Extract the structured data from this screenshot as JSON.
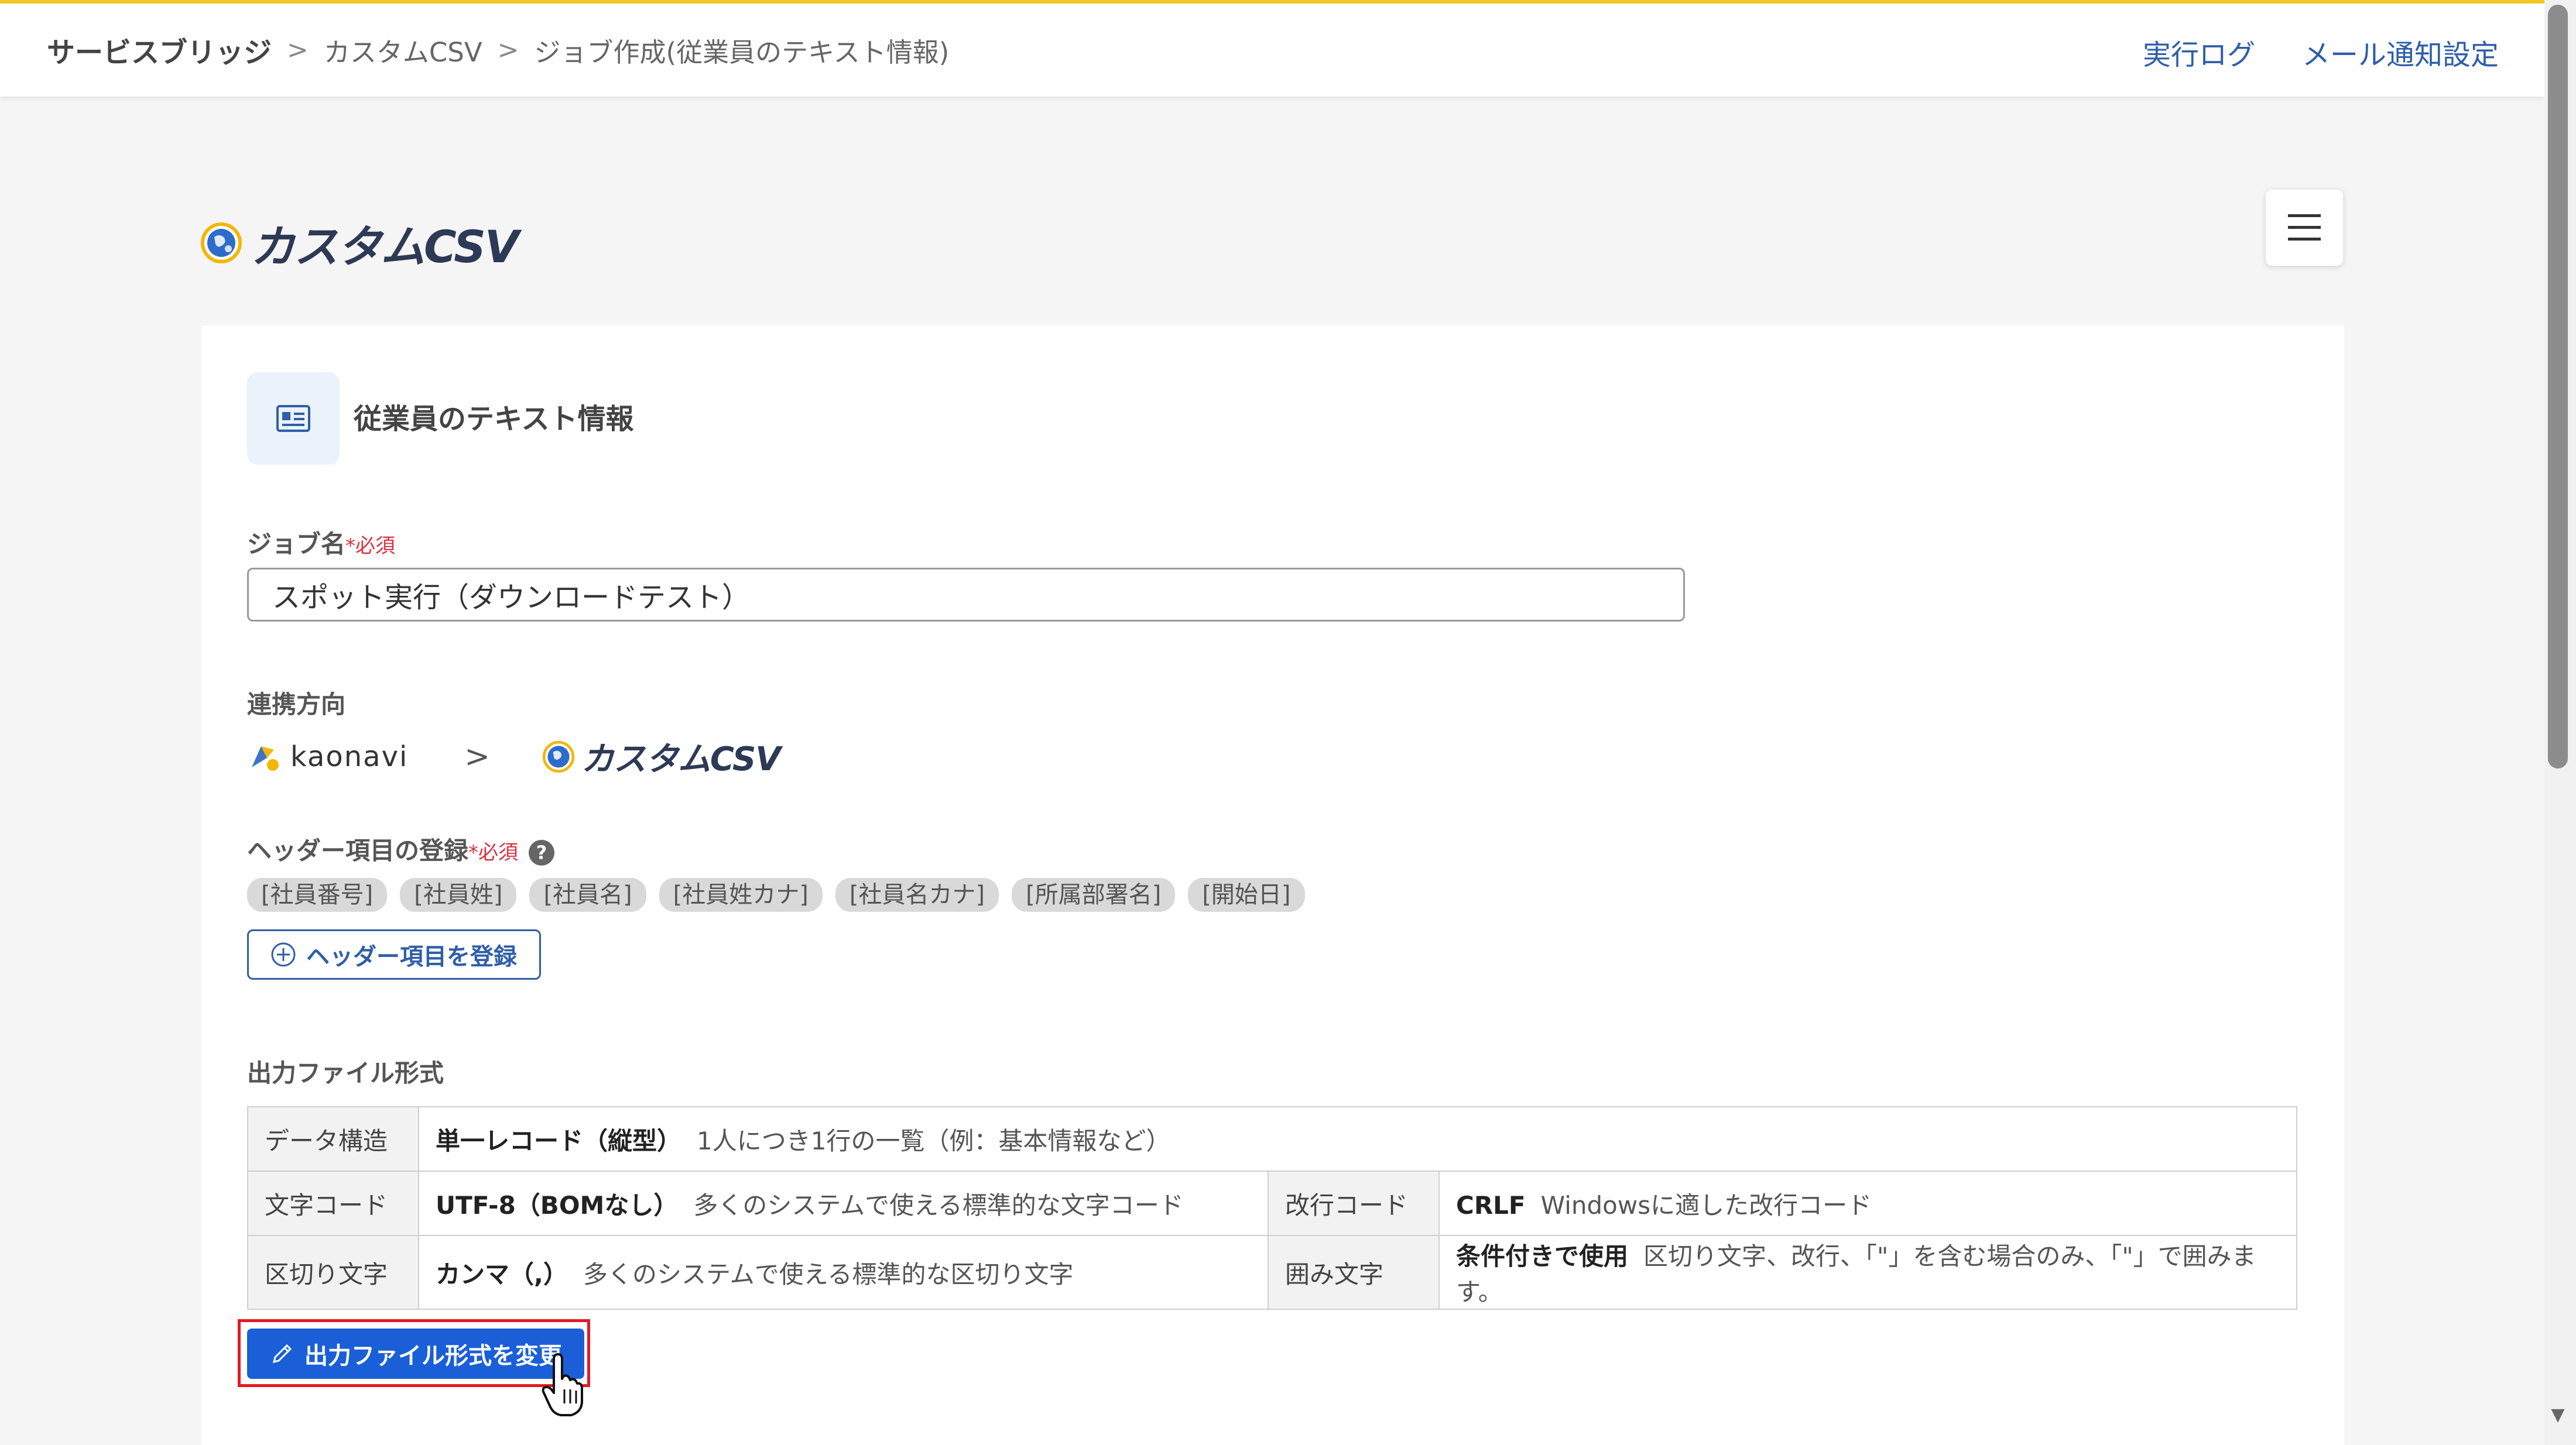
{
  "breadcrumb": {
    "root": "サービスブリッジ",
    "items": [
      "カスタムCSV",
      "ジョブ作成(従業員のテキスト情報)"
    ],
    "separator": ">"
  },
  "top_links": {
    "log": "実行ログ",
    "mail": "メール通知設定"
  },
  "brand": {
    "name": "カスタムCSV"
  },
  "job": {
    "title": "従業員のテキスト情報"
  },
  "form": {
    "job_name_label": "ジョブ名",
    "required_mark": "*必須",
    "job_name_value": "スポット実行（ダウンロードテスト）",
    "direction_label": "連携方向",
    "direction_source": "kaonavi",
    "direction_target": "カスタムCSV",
    "direction_arrow": ">",
    "header_label": "ヘッダー項目の登録",
    "help": "?",
    "header_chips": [
      "[社員番号]",
      "[社員姓]",
      "[社員名]",
      "[社員姓カナ]",
      "[社員名カナ]",
      "[所属部署名]",
      "[開始日]"
    ],
    "register_header_button": "ヘッダー項目を登録"
  },
  "output": {
    "section_label": "出力ファイル形式",
    "rows": {
      "data_structure": {
        "label": "データ構造",
        "value": "単一レコード（縦型）",
        "desc": "1人につき1行の一覧（例：基本情報など）"
      },
      "charset": {
        "label": "文字コード",
        "value": "UTF-8（BOMなし）",
        "desc": "多くのシステムで使える標準的な文字コード"
      },
      "newline": {
        "label": "改行コード",
        "value": "CRLF",
        "desc": "Windowsに適した改行コード"
      },
      "delimiter": {
        "label": "区切り文字",
        "value": "カンマ（,）",
        "desc": "多くのシステムで使える標準的な区切り文字"
      },
      "quote": {
        "label": "囲み文字",
        "value": "条件付きで使用",
        "desc": "区切り文字、改行、「\"」を含む場合のみ、「\"」で囲みます。"
      }
    },
    "change_button": "出力ファイル形式を変更"
  },
  "colors": {
    "accent": "#1a5fd8",
    "link": "#2f5ea8",
    "required": "#d9323f",
    "highlight": "#e01b24",
    "topbar_border": "#f3c623"
  }
}
